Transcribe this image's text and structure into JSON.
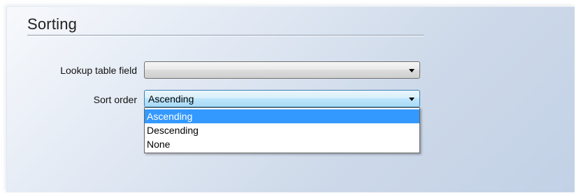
{
  "section": {
    "title": "Sorting"
  },
  "fields": {
    "lookup_table_field": {
      "label": "Lookup table field",
      "value": ""
    },
    "sort_order": {
      "label": "Sort order",
      "value": "Ascending",
      "dropdown_open": true,
      "options": [
        "Ascending",
        "Descending",
        "None"
      ],
      "highlighted_option": "Ascending"
    }
  },
  "icons": {
    "dropdown_arrow": "chevron-down-icon"
  },
  "colors": {
    "selection_highlight": "#3399ff",
    "focused_combo_border": "#3c7fb1",
    "panel_gradient_end": "#c2d1e6"
  }
}
